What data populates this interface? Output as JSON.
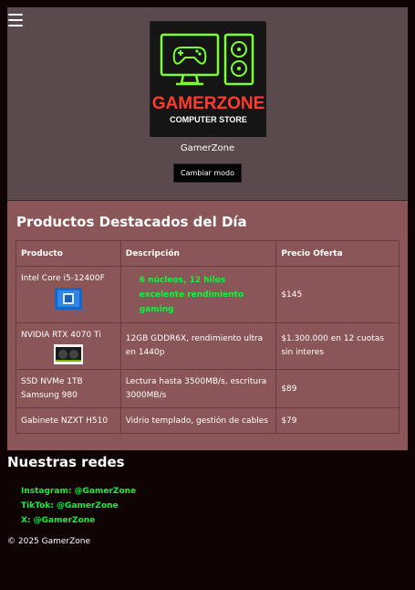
{
  "header": {
    "menu_icon": "hamburger-menu-icon",
    "logo": {
      "title": "GAMERZONE",
      "subtitle": "COMPUTER STORE",
      "colors": {
        "title": "#ff3b2f",
        "icon": "#7cff35"
      }
    },
    "brand_name": "GamerZone",
    "mode_button": "Cambiar modo"
  },
  "products": {
    "title": "Productos Destacados del Día",
    "columns": [
      "Producto",
      "Descripción",
      "Precio Oferta"
    ],
    "rows": [
      {
        "name": "Intel Core i5-12400F",
        "description_lines": [
          "6 núcleos, 12 hilos",
          "excelente rendimiento gaming"
        ],
        "price": "$145"
      },
      {
        "name": "NVIDIA RTX 4070 Ti",
        "description": "12GB GDDR6X, rendimiento ultra en 1440p",
        "price": "$1.300.000 en 12 cuotas sin interes"
      },
      {
        "name": "SSD NVMe 1TB Samsung 980",
        "description": "Lectura hasta 3500MB/s, escritura 3000MB/s",
        "price": "$89"
      },
      {
        "name": "Gabinete NZXT H510",
        "description": "Vidrio templado, gestión de cables",
        "price": "$79"
      }
    ]
  },
  "networks": {
    "title": "Nuestras redes",
    "links": [
      "Instagram: @GamerZone",
      "TikTok: @GamerZone",
      "X: @GamerZone"
    ]
  },
  "footer": {
    "text": "© 2025 GamerZone"
  },
  "colors": {
    "accent_green": "#12f23e",
    "header_bg": "#5b4a4d",
    "products_bg": "#8b5657",
    "page_bg": "#0e0202"
  }
}
